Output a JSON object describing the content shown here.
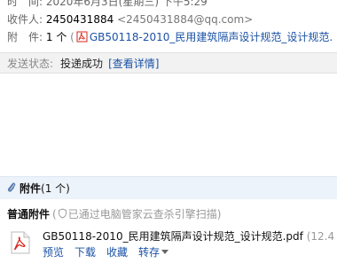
{
  "header": {
    "time_label": "时　间:",
    "time_value": "2020年6月3日(星期三) 下午5:29",
    "sender_label": "收件人:",
    "sender_name": "2450431884",
    "sender_email": "<2450431884@qq.com>",
    "attachment_label": "附　件:",
    "attachment_count": "1 个",
    "attachment_open": "(",
    "attachment_link": "GB50118-2010_民用建筑隔声设计规范_设计规范."
  },
  "status": {
    "label": "发送状态:",
    "value": "投递成功",
    "detail_link": "[查看详情]"
  },
  "attachments": {
    "title": "附件",
    "count": "(1 个)",
    "section_label": "普通附件",
    "scan_prefix": "(",
    "scan_note": "已通过电脑管家云查杀引擎扫描)",
    "file": {
      "name": "GB50118-2010_民用建筑隔声设计规范_设计规范.pdf",
      "size": "(12.4",
      "actions": {
        "preview": "预览",
        "download": "下载",
        "favorite": "收藏",
        "save_to": "转存"
      }
    }
  },
  "icons": {
    "pdf": "pdf-file-icon",
    "clip": "paperclip-icon",
    "shield": "shield-icon",
    "caret": "chevron-down-icon"
  },
  "colors": {
    "link": "#1b52a5",
    "status_bar_bg": "#f2f2f2",
    "attach_bar_bg": "#edf3fb",
    "pdf_red": "#d8261c"
  }
}
